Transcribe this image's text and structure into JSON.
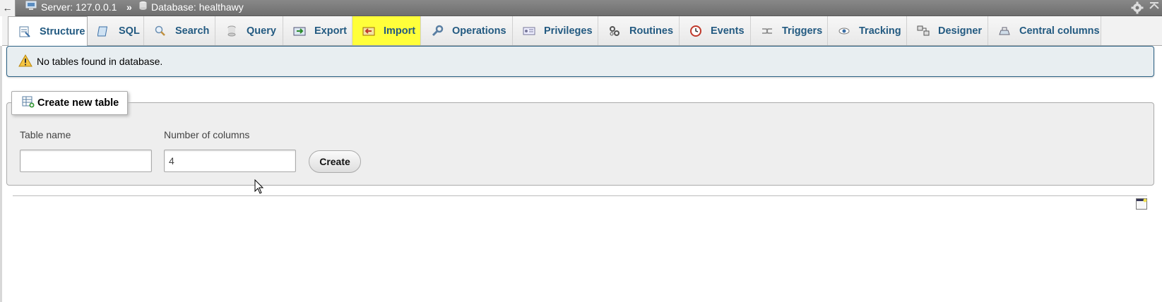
{
  "topbar": {
    "back": "←",
    "server": "Server: 127.0.0.1",
    "separator": "»",
    "database": "Database: healthawy"
  },
  "tabs": [
    {
      "label": "Structure",
      "icon": "structure-icon"
    },
    {
      "label": "SQL",
      "icon": "sql-icon"
    },
    {
      "label": "Search",
      "icon": "search-icon"
    },
    {
      "label": "Query",
      "icon": "query-icon"
    },
    {
      "label": "Export",
      "icon": "export-icon"
    },
    {
      "label": "Import",
      "icon": "import-icon"
    },
    {
      "label": "Operations",
      "icon": "wrench-icon"
    },
    {
      "label": "Privileges",
      "icon": "privileges-icon"
    },
    {
      "label": "Routines",
      "icon": "routines-icon"
    },
    {
      "label": "Events",
      "icon": "clock-icon"
    },
    {
      "label": "Triggers",
      "icon": "triggers-icon"
    },
    {
      "label": "Tracking",
      "icon": "eye-icon"
    },
    {
      "label": "Designer",
      "icon": "designer-icon"
    },
    {
      "label": "Central columns",
      "icon": "central-columns-icon"
    }
  ],
  "notice": {
    "text": "No tables found in database."
  },
  "create_table": {
    "legend": "Create new table",
    "table_name_label": "Table name",
    "table_name_value": "",
    "num_columns_label": "Number of columns",
    "num_columns_value": "4",
    "create_button": "Create"
  },
  "colors": {
    "tab_text": "#235a81",
    "highlight": "#ffff3a",
    "notice_bg": "#e8eef1",
    "notice_border": "#2c6285"
  }
}
